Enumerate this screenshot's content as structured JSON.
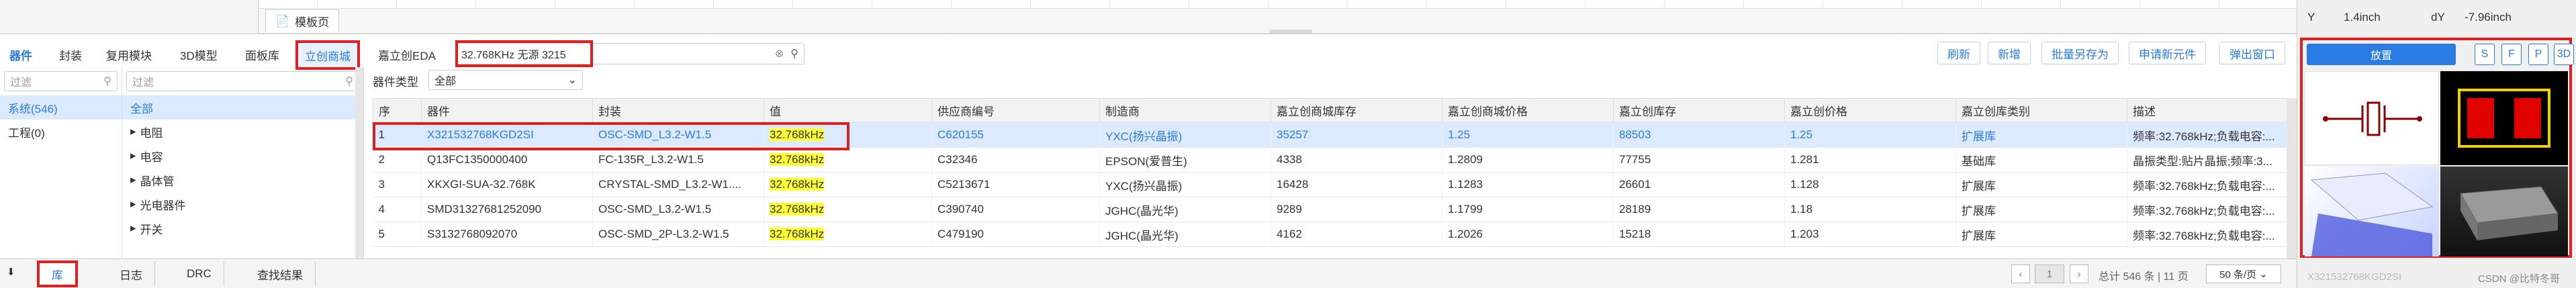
{
  "doc_tab": {
    "label": "模板页"
  },
  "right_panel": {
    "y_label": "Y",
    "y_value": "1.4inch",
    "dy_label": "dY",
    "dy_value": "-7.96inch",
    "place_button": "放置",
    "view_buttons": [
      "S",
      "F",
      "P",
      "3D"
    ],
    "preview_caption": "X321532768KGD2SI",
    "watermark": "CSDN @比特冬哥"
  },
  "tabs": [
    "器件",
    "封装",
    "复用模块",
    "3D模型",
    "面板库",
    "立创商城",
    "嘉立创EDA"
  ],
  "search": {
    "value": "32.768KHz 无源 3215"
  },
  "action_buttons": [
    "刷新",
    "新增",
    "批量另存为",
    "申请新元件",
    "弹出窗口"
  ],
  "filter_placeholder": "过滤",
  "left_list": [
    "系统(546)",
    "工程(0)"
  ],
  "type_label": "器件类型",
  "type_select": "全部",
  "tree": {
    "all": "全部",
    "items": [
      "电阻",
      "电容",
      "晶体管",
      "光电器件",
      "开关"
    ]
  },
  "table": {
    "columns": [
      "序",
      "器件",
      "封装",
      "值",
      "供应商编号",
      "制造商",
      "嘉立创商城库存",
      "嘉立创商城价格",
      "嘉立创库存",
      "嘉立创价格",
      "嘉立创库类别",
      "描述"
    ],
    "rows": [
      [
        "1",
        "X321532768KGD2SI",
        "OSC-SMD_L3.2-W1.5",
        "32.768kHz",
        "C620155",
        "YXC(扬兴晶振)",
        "35257",
        "1.25",
        "88503",
        "1.25",
        "扩展库",
        "频率:32.768kHz;负载电容:..."
      ],
      [
        "2",
        "Q13FC1350000400",
        "FC-135R_L3.2-W1.5",
        "32.768kHz",
        "C32346",
        "EPSON(爱普生)",
        "4338",
        "1.2809",
        "77755",
        "1.281",
        "基础库",
        "晶振类型:贴片晶振;频率:3..."
      ],
      [
        "3",
        "XKXGI-SUA-32.768K",
        "CRYSTAL-SMD_L3.2-W1....",
        "32.768kHz",
        "C5213671",
        "YXC(扬兴晶振)",
        "16428",
        "1.1283",
        "26601",
        "1.128",
        "扩展库",
        "频率:32.768kHz;负载电容:..."
      ],
      [
        "4",
        "SMD31327681252090",
        "OSC-SMD_L3.2-W1.5",
        "32.768kHz",
        "C390740",
        "JGHC(晶光华)",
        "9289",
        "1.1799",
        "28189",
        "1.18",
        "扩展库",
        "频率:32.768kHz;负载电容:..."
      ],
      [
        "5",
        "S3132768092070",
        "OSC-SMD_2P-L3.2-W1.5",
        "32.768kHz",
        "C479190",
        "JGHC(晶光华)",
        "4162",
        "1.2026",
        "15218",
        "1.203",
        "扩展库",
        "频率:32.768kHz;负载电容:..."
      ]
    ]
  },
  "bottom_tabs": [
    "库",
    "日志",
    "DRC",
    "查找结果"
  ],
  "pagination": {
    "page": "1",
    "summary": "总计 546 条 | 11 页",
    "per_page": "50 条/页"
  }
}
